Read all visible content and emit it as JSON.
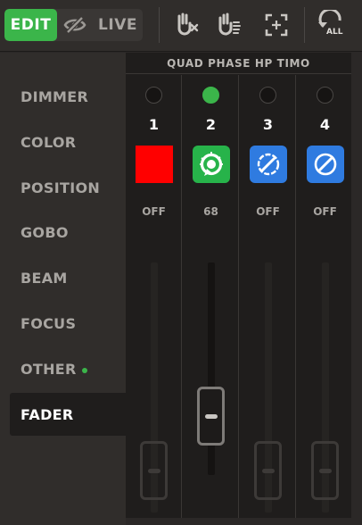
{
  "toolbar": {
    "edit_label": "EDIT",
    "hide_icon": "eye-slash-icon",
    "live_label": "LIVE",
    "icons": [
      "knob-clear-icon",
      "knob-highlight-icon",
      "focus-select-icon",
      "undo-all-icon"
    ],
    "undo_all_label": "ALL"
  },
  "nav": {
    "items": [
      {
        "label": "DIMMER"
      },
      {
        "label": "COLOR"
      },
      {
        "label": "POSITION"
      },
      {
        "label": "GOBO"
      },
      {
        "label": "BEAM"
      },
      {
        "label": "FOCUS"
      },
      {
        "label": "OTHER",
        "indicator": true
      },
      {
        "label": "FADER",
        "active": true
      }
    ]
  },
  "panel": {
    "title": "QUAD PHASE HP TIMO",
    "columns": [
      {
        "number": "1",
        "led_on": false,
        "swatch": "red-swatch",
        "value": "OFF",
        "fader_level": 0.0
      },
      {
        "number": "2",
        "led_on": true,
        "swatch": "strobe-green-icon",
        "value": "68",
        "fader_level": 0.27
      },
      {
        "number": "3",
        "led_on": false,
        "swatch": "blocked-blue-icon",
        "value": "OFF",
        "fader_level": 0.0
      },
      {
        "number": "4",
        "led_on": false,
        "swatch": "blocked-blue-icon",
        "value": "OFF",
        "fader_level": 0.0
      }
    ]
  },
  "colors": {
    "accent_green": "#3bb54a",
    "red": "#ff0000",
    "blue": "#2f7be0",
    "green_tile": "#27b34a"
  }
}
